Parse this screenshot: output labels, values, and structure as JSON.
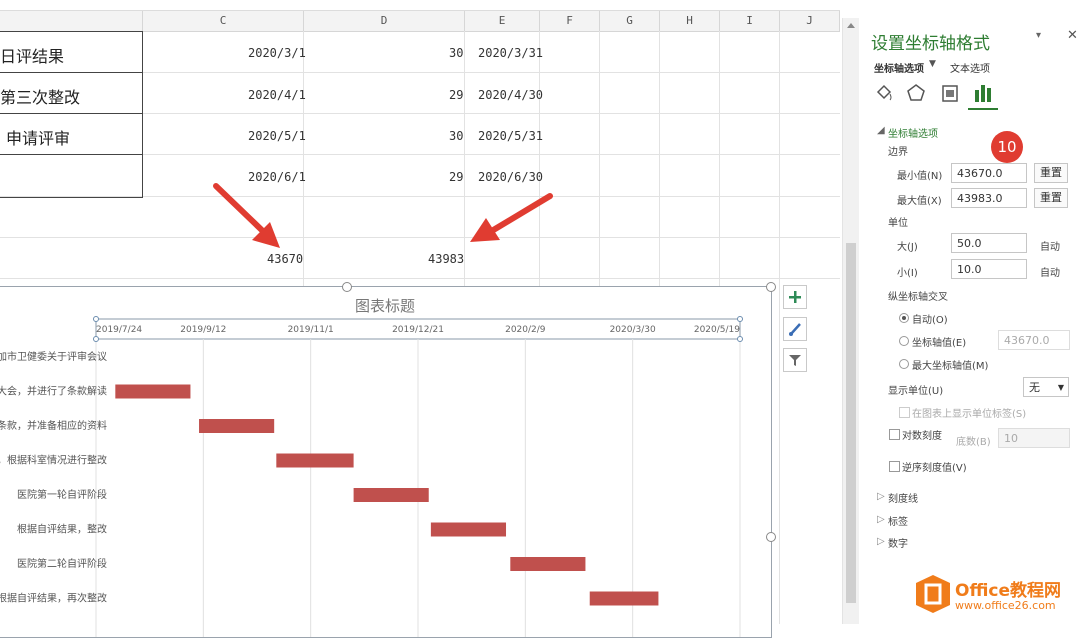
{
  "columns": [
    "C",
    "D",
    "E",
    "F",
    "G",
    "H",
    "I",
    "J"
  ],
  "rows": [
    {
      "b": "日评结果",
      "c": "2020/3/1",
      "d": "30",
      "e": "2020/3/31"
    },
    {
      "b": "第三次整改",
      "c": "2020/4/1",
      "d": "29",
      "e": "2020/4/30"
    },
    {
      "b": "申请评审",
      "c": "2020/5/1",
      "d": "30",
      "e": "2020/5/31"
    },
    {
      "b": "",
      "c": "2020/6/1",
      "d": "29",
      "e": "2020/6/30"
    }
  ],
  "cell_values": {
    "c_bound": "43670",
    "d_bound": "43983"
  },
  "chart": {
    "title": "图表标题",
    "axis_ticks": [
      "2019/7/24",
      "2019/9/12",
      "2019/11/1",
      "2019/12/21",
      "2020/2/9",
      "2020/3/30",
      "2020/5/19"
    ],
    "categories": [
      "加市卫健委关于评审会议",
      "大会，并进行了条款解读",
      "条款，并准备相应的资料",
      "，根据科室情况进行整改",
      "医院第一轮自评阶段",
      "根据自评结果，整改",
      "医院第二轮自评阶段",
      "根据自评结果，再次整改"
    ],
    "bar_color": "#c0504d"
  },
  "chart_data": {
    "type": "bar",
    "orientation": "horizontal",
    "title": "图表标题",
    "xlim": [
      "2019/7/24",
      "2020/5/19"
    ],
    "tick_labels": [
      "2019/7/24",
      "2019/9/12",
      "2019/11/1",
      "2019/12/21",
      "2020/2/9",
      "2020/3/30",
      "2020/5/19"
    ],
    "categories": [
      "加市卫健委关于评审会议",
      "大会，并进行了条款解读",
      "条款，并准备相应的资料",
      "，根据科室情况进行整改",
      "医院第一轮自评阶段",
      "根据自评结果，整改",
      "医院第二轮自评阶段",
      "根据自评结果，再次整改"
    ],
    "series": [
      {
        "start_days": [
          0,
          9,
          48,
          84,
          120,
          156,
          193,
          230
        ],
        "duration_days": [
          0,
          35,
          35,
          36,
          35,
          35,
          35,
          32
        ]
      }
    ],
    "grid": true
  },
  "pane": {
    "title": "设置坐标轴格式",
    "tab_axis_options": "坐标轴选项",
    "tab_text_options": "文本选项",
    "section_axis": "坐标轴选项",
    "bounds_label": "边界",
    "min_label": "最小值(N)",
    "min_value": "43670.0",
    "max_label": "最大值(X)",
    "max_value": "43983.0",
    "reset": "重置",
    "units_label": "单位",
    "major_label": "大(J)",
    "major_value": "50.0",
    "minor_label": "小(I)",
    "minor_value": "10.0",
    "auto": "自动",
    "cross_label": "纵坐标轴交叉",
    "cross_auto": "自动(O)",
    "cross_value_label": "坐标轴值(E)",
    "cross_value": "43670.0",
    "cross_max": "最大坐标轴值(M)",
    "display_units_label": "显示单位(U)",
    "display_units_value": "无",
    "show_units_label": "在图表上显示单位标签(S)",
    "log_scale": "对数刻度",
    "log_base_label": "底数(B)",
    "log_base_value": "10",
    "reverse": "逆序刻度值(V)",
    "tick_marks": "刻度线",
    "labels": "标签",
    "number": "数字",
    "badge": "10"
  },
  "watermark": {
    "title": "Office教程网",
    "url": "www.office26.com"
  }
}
